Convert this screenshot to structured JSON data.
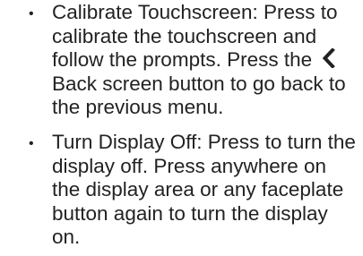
{
  "bullet_symbol": "•",
  "items": [
    {
      "text_before_icon": "Calibrate Touchscreen: Press to calibrate the touchscreen and follow the prompts. Press the",
      "icon": "chevron-left-icon",
      "text_after_icon": "Back screen button to go back to the previous menu."
    },
    {
      "text": "Turn Display Off: Press to turn the display off. Press anywhere on the display area or any faceplate button again to turn the display on."
    }
  ]
}
